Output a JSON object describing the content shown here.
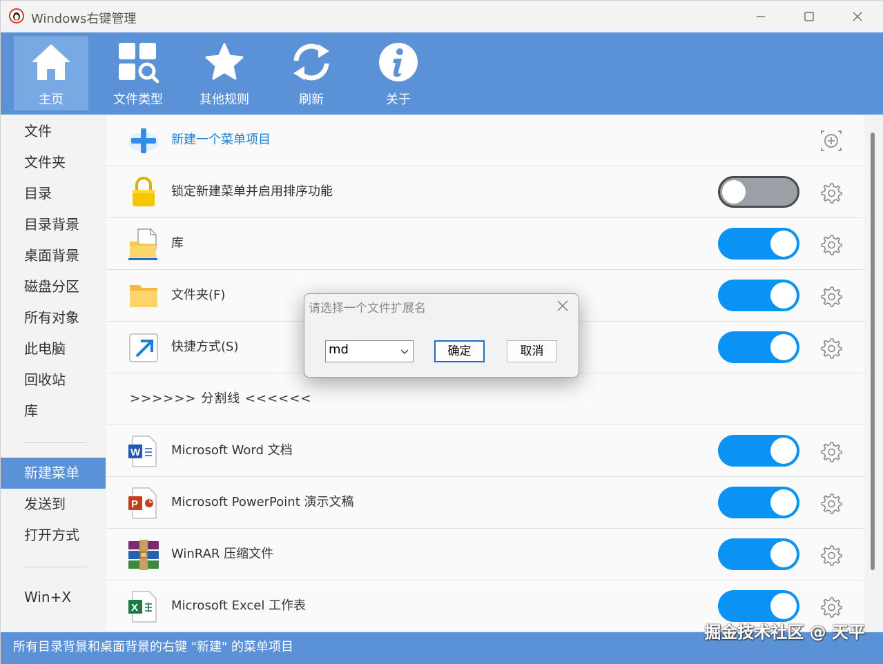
{
  "window": {
    "title": "Windows右键管理"
  },
  "toolbar": {
    "items": [
      {
        "label": "主页",
        "icon": "home-icon",
        "active": true
      },
      {
        "label": "文件类型",
        "icon": "file-types-icon"
      },
      {
        "label": "其他规则",
        "icon": "star-icon"
      },
      {
        "label": "刷新",
        "icon": "refresh-icon"
      },
      {
        "label": "关于",
        "icon": "info-icon"
      }
    ]
  },
  "sidebar": {
    "items": [
      {
        "label": "文件"
      },
      {
        "label": "文件夹"
      },
      {
        "label": "目录"
      },
      {
        "label": "目录背景"
      },
      {
        "label": "桌面背景"
      },
      {
        "label": "磁盘分区"
      },
      {
        "label": "所有对象"
      },
      {
        "label": "此电脑"
      },
      {
        "label": "回收站"
      },
      {
        "label": "库"
      },
      {
        "label": "新建菜单",
        "active": true
      },
      {
        "label": "发送到"
      },
      {
        "label": "打开方式"
      },
      {
        "label": "Win+X"
      }
    ]
  },
  "content": {
    "new_item": {
      "label": "新建一个菜单项目",
      "icon": "add-icon"
    },
    "rows": [
      {
        "label": "锁定新建菜单并启用排序功能",
        "icon": "lock-icon",
        "enabled": false
      },
      {
        "label": "库",
        "icon": "library-icon",
        "enabled": true
      },
      {
        "label": "文件夹(F)",
        "icon": "folder-icon",
        "enabled": true
      },
      {
        "label": "快捷方式(S)",
        "icon": "shortcut-icon",
        "enabled": true
      },
      {
        "separator": ">>>>>> 分割线 <<<<<<"
      },
      {
        "label": "Microsoft Word 文档",
        "icon": "word-icon",
        "enabled": true
      },
      {
        "label": "Microsoft PowerPoint 演示文稿",
        "icon": "powerpoint-icon",
        "enabled": true
      },
      {
        "label": "WinRAR 压缩文件",
        "icon": "winrar-icon",
        "enabled": true
      },
      {
        "label": "Microsoft Excel 工作表",
        "icon": "excel-icon",
        "enabled": true
      }
    ]
  },
  "dialog": {
    "title": "请选择一个文件扩展名",
    "select_value": "md",
    "ok_label": "确定",
    "cancel_label": "取消"
  },
  "status": {
    "text": "所有目录背景和桌面背景的右键 \"新建\" 的菜单项目",
    "watermark": "掘金技术社区 @ 天平"
  },
  "colors": {
    "toolbar": "#5b92d7",
    "toolbar_active": "#79a9e3",
    "toggle_on": "#0a93f5",
    "toggle_off": "#9aa0a6",
    "link": "#1a7fd6"
  }
}
